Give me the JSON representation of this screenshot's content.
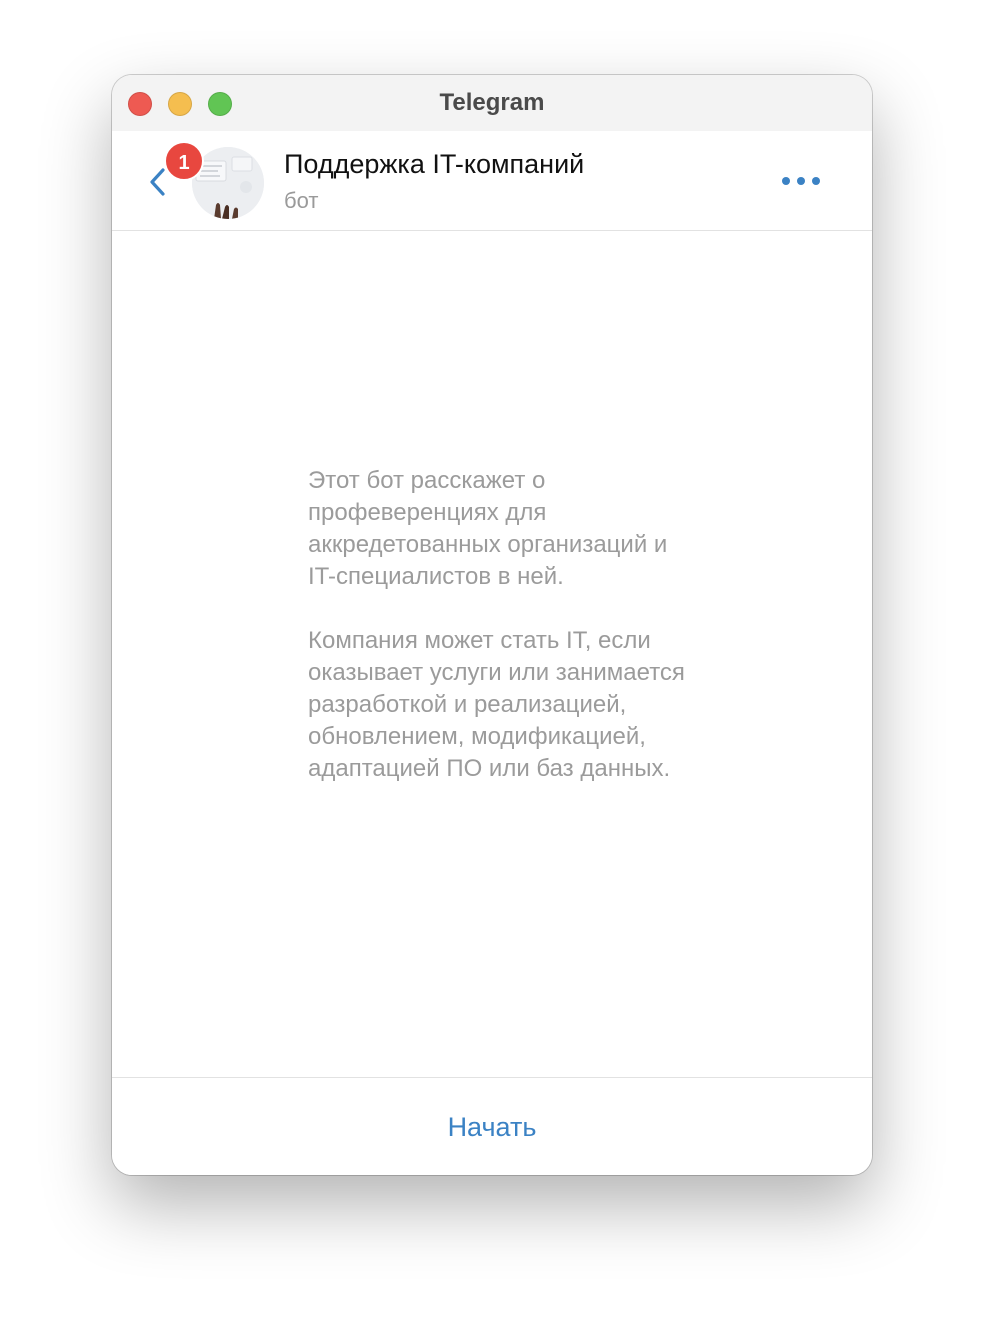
{
  "window": {
    "title": "Telegram"
  },
  "header": {
    "unread_badge": "1",
    "chat_name": "Поддержка IT-компаний",
    "chat_status": "бот",
    "back_icon": "chevron-left-icon",
    "more_icon": "ellipsis-icon"
  },
  "intro": {
    "paragraph_1": "Этот бот расскажет о профеверенциях для аккредетованных организаций и IT-специалистов в ней.",
    "paragraph_2": "Компания может стать IT, если оказывает услуги или занимается разработкой и реализацией, обновлением, модификацией, адаптацией ПО или баз данных."
  },
  "footer": {
    "start_label": "Начать"
  },
  "colors": {
    "accent": "#3b82c4",
    "badge": "#e8473f",
    "traffic_close": "#ee5a52",
    "traffic_minimize": "#f5be4f",
    "traffic_zoom": "#61c554"
  }
}
